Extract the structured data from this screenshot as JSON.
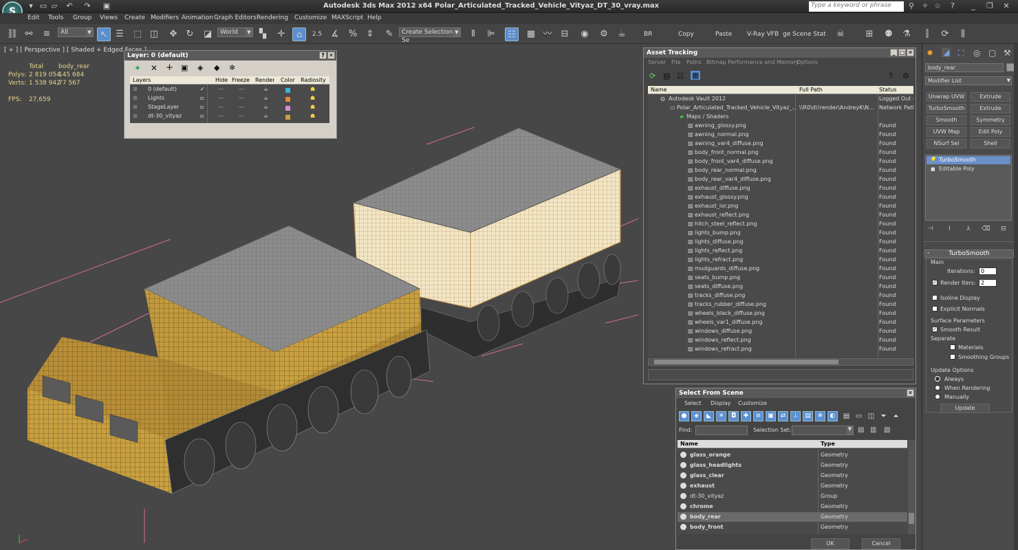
{
  "app": {
    "title": "Autodesk 3ds Max  2012 x64     Polar_Articulated_Tracked_Vehicle_Vityaz_DT_30_vray.max",
    "logo": "S",
    "search_placeholder": "Type a keyword or phrase"
  },
  "menu": [
    "Edit",
    "Tools",
    "Group",
    "Views",
    "Create",
    "Modifiers",
    "Animation",
    "Graph Editors",
    "Rendering",
    "Customize",
    "MAXScript",
    "Help"
  ],
  "toolbar": {
    "selection_filter": "All",
    "ref_coord": "World",
    "snap_value": "2.5",
    "named_selection": "Create Selection Se",
    "labels": [
      "BR",
      "Copy",
      "Paste",
      "V-Ray VFB",
      "ge Scene Stat"
    ]
  },
  "viewport": {
    "label": "[ + ] [ Perspective ] [ Shaded + Edged Faces ]",
    "stats": {
      "total_label": "Total",
      "object_label": "body_rear",
      "polys_label": "Polys:",
      "polys_total": "2 819 054",
      "polys_obj": "145 684",
      "verts_label": "Verts:",
      "verts_total": "1 538 942",
      "verts_obj": "77 567",
      "fps_label": "FPS:",
      "fps": "27,659"
    }
  },
  "layer_panel": {
    "title": "Layer: 0 (default)",
    "columns": [
      "Layers",
      "Hide",
      "Freeze",
      "Render",
      "Color",
      "Radiosity"
    ],
    "layers": [
      {
        "name": "0 (default)",
        "color": "#3ab7d9",
        "active": true
      },
      {
        "name": "Lights",
        "color": "#e08a3a",
        "active": false
      },
      {
        "name": "StageLayer",
        "color": "#d98ad9",
        "active": false
      },
      {
        "name": "dt-30_vityaz",
        "color": "#c9a23a",
        "active": false
      }
    ]
  },
  "asset_tracking": {
    "title": "Asset Tracking",
    "menu": [
      "Server",
      "File",
      "Paths",
      "Bitmap Performance and Memory",
      "Options"
    ],
    "columns": [
      "Name",
      "Full Path",
      "Status"
    ],
    "vault": {
      "name": "Autodesk Vault 2012",
      "status": "Logged Out ("
    },
    "file": {
      "name": "Polar_Articulated_Tracked_Vehicle_Vityaz_...",
      "path": "\\\\R0\\d\\!render\\AndreyK\\N...",
      "status": "Network Path"
    },
    "group": "Maps / Shaders",
    "maps": [
      "awning_glossy.png",
      "awning_normal.png",
      "awning_var4_diffuse.png",
      "body_front_normal.png",
      "body_front_var4_diffuse.png",
      "body_rear_normal.png",
      "body_rear_var4_diffuse.png",
      "exhaust_diffuse.png",
      "exhaust_glossy.png",
      "exhaust_ior.png",
      "exhaust_reflect.png",
      "hitch_steel_reflect.png",
      "lights_bump.png",
      "lights_diffuse.png",
      "lights_reflect.png",
      "lights_refract.png",
      "mudguards_diffuse.png",
      "seats_bump.png",
      "seats_diffuse.png",
      "tracks_diffuse.png",
      "tracks_rubber_diffuse.png",
      "wheels_black_diffuse.png",
      "wheels_var1_diffuse.png",
      "windows_diffuse.png",
      "windows_reflect.png",
      "windows_refract.png"
    ],
    "map_status": "Found"
  },
  "select_scene": {
    "title": "Select From Scene",
    "menu": [
      "Select",
      "Display",
      "Customize"
    ],
    "find_label": "Find:",
    "selset_label": "Selection Set:",
    "columns": [
      "Name",
      "Type"
    ],
    "rows": [
      {
        "name": "glass_orange",
        "type": "Geometry",
        "bold": true,
        "selected": false
      },
      {
        "name": "glass_headlights",
        "type": "Geometry",
        "bold": true,
        "selected": false
      },
      {
        "name": "glass_clear",
        "type": "Geometry",
        "bold": true,
        "selected": false
      },
      {
        "name": "exhaust",
        "type": "Geometry",
        "bold": true,
        "selected": false
      },
      {
        "name": "dt-30_vityaz",
        "type": "Group",
        "bold": false,
        "selected": false
      },
      {
        "name": "chrome",
        "type": "Geometry",
        "bold": true,
        "selected": false
      },
      {
        "name": "body_rear",
        "type": "Geometry",
        "bold": true,
        "selected": true
      },
      {
        "name": "body_front",
        "type": "Geometry",
        "bold": true,
        "selected": false
      }
    ],
    "ok": "OK",
    "cancel": "Cancel"
  },
  "command_panel": {
    "object_name": "body_rear",
    "modifier_list": "Modifier List",
    "buttons": [
      "Unwrap UVW",
      "Extrude",
      "TurboSmooth",
      "Extrude",
      "Smooth",
      "Symmetry",
      "UVW Map",
      "Edit Poly",
      "NSurf Sel",
      "Shell"
    ],
    "stack": [
      "TurboSmooth",
      "Editable Poly"
    ],
    "rollout": "TurboSmooth",
    "main_label": "Main",
    "iterations_label": "Iterations:",
    "iterations": "0",
    "render_iters_label": "Render Iters:",
    "render_iters": "2",
    "isoline": "Isoline Display",
    "explicit": "Explicit Normals",
    "surface_params": "Surface Parameters",
    "smooth_result": "Smooth Result",
    "separate": "Separate",
    "materials": "Materials",
    "smoothing_groups": "Smoothing Groups",
    "update_options": "Update Options",
    "always": "Always",
    "when_rendering": "When Rendering",
    "manually": "Manually",
    "update": "Update"
  }
}
